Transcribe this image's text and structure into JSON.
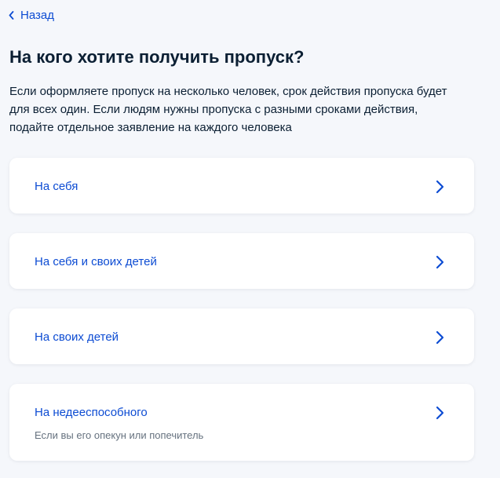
{
  "nav": {
    "back_label": "Назад",
    "back_icon": "chevron-left-icon"
  },
  "header": {
    "title": "На кого хотите получить пропуск?"
  },
  "intro": {
    "text": "Если оформляете пропуск на несколько человек, срок действия пропуска будет для всех один. Если людям нужны пропуска с разными сроками действия, подайте отдельное заявление на каждого человека"
  },
  "options": [
    {
      "label": "На себя",
      "subtitle": ""
    },
    {
      "label": "На себя и своих детей",
      "subtitle": ""
    },
    {
      "label": "На своих детей",
      "subtitle": ""
    },
    {
      "label": "На недееспособного",
      "subtitle": "Если вы его опекун или попечитель"
    }
  ],
  "colors": {
    "page_background": "#f5f7fb",
    "card_background": "#ffffff",
    "link_blue": "#0d4cd3",
    "text_primary": "#0b1f33",
    "text_secondary": "#66727f"
  }
}
